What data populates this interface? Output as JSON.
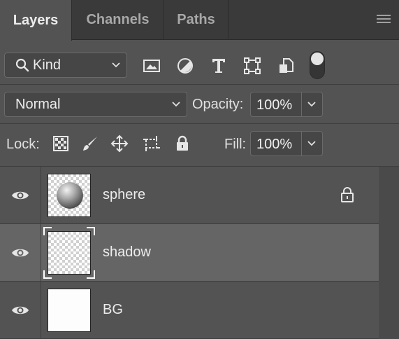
{
  "tabs": [
    {
      "label": "Layers",
      "active": true
    },
    {
      "label": "Channels",
      "active": false
    },
    {
      "label": "Paths",
      "active": false
    }
  ],
  "filter": {
    "kind_label": "Kind",
    "icons": [
      "image-filter-icon",
      "adjustment-filter-icon",
      "type-filter-icon",
      "shape-filter-icon",
      "smart-object-filter-icon"
    ]
  },
  "blend": {
    "mode": "Normal",
    "opacity_label": "Opacity:",
    "opacity_value": "100%"
  },
  "lock": {
    "label": "Lock:",
    "fill_label": "Fill:",
    "fill_value": "100%"
  },
  "layers": [
    {
      "name": "sphere",
      "visible": true,
      "locked": true,
      "selected": false,
      "thumbnail": "sphere-on-transparent"
    },
    {
      "name": "shadow",
      "visible": true,
      "locked": false,
      "selected": true,
      "thumbnail": "transparent"
    },
    {
      "name": "BG",
      "visible": true,
      "locked": false,
      "selected": false,
      "thumbnail": "white"
    }
  ],
  "colors": {
    "panel_bg": "#535353",
    "tab_bar_bg": "#3a3a3a",
    "selected_row": "#656565",
    "text": "#ececec"
  }
}
